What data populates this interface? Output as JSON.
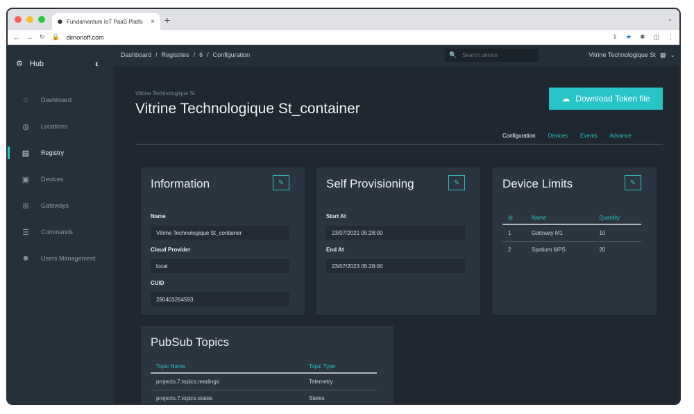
{
  "browser": {
    "tab_title": "Fundamentum IoT PaaS Platfo",
    "tab_close": "×",
    "new_tab": "+",
    "url": "dimonoff.com"
  },
  "sidebar": {
    "hub_label": "Hub",
    "collapse_icon": "‹",
    "items": [
      {
        "label": "Dashboard",
        "icon": "home-icon",
        "active": false
      },
      {
        "label": "Locations",
        "icon": "globe-icon",
        "active": false
      },
      {
        "label": "Registry",
        "icon": "clipboard-icon",
        "active": true
      },
      {
        "label": "Devices",
        "icon": "devices-icon",
        "active": false
      },
      {
        "label": "Gateways",
        "icon": "network-icon",
        "active": false
      },
      {
        "label": "Commands",
        "icon": "list-icon",
        "active": false
      },
      {
        "label": "Users Management",
        "icon": "users-icon",
        "active": false
      }
    ]
  },
  "topbar": {
    "breadcrumb": [
      "Dashboard",
      "/",
      "Registries",
      "/",
      "6",
      "/",
      "Configuration"
    ],
    "search_placeholder": "Search device",
    "org_name": "Vitrine Technologique St"
  },
  "page": {
    "subtitle": "Vitrine Technologique St",
    "title": "Vitrine Technologique St_container",
    "download_label": "Download Token file",
    "tabs": [
      "Configuration",
      "Devices",
      "Events",
      "Advance"
    ]
  },
  "information": {
    "heading": "Information",
    "name_label": "Name",
    "name_value": "Vitrine Technologique St_container",
    "cloud_label": "Cloud Provider",
    "cloud_value": "local",
    "cuid_label": "CUID",
    "cuid_value": "280403264593"
  },
  "self_provisioning": {
    "heading": "Self Provisioning",
    "start_label": "Start At",
    "start_value": "23/07/2021 05:28:00",
    "end_label": "End At",
    "end_value": "23/07/2023 05:28:00"
  },
  "device_limits": {
    "heading": "Device Limits",
    "columns": [
      "Id",
      "Name",
      "Quantity"
    ],
    "rows": [
      [
        "1",
        "Gateway M1",
        "10"
      ],
      [
        "2",
        "Spatium MPS",
        "20"
      ]
    ]
  },
  "pubsub": {
    "heading": "PubSub Topics",
    "columns": [
      "Topic Name",
      "Topic Type"
    ],
    "rows": [
      [
        "projects.7.topics.readings",
        "Telemetry"
      ],
      [
        "projects.7.topics.states",
        "States"
      ]
    ]
  },
  "colors": {
    "accent": "#28c4c8",
    "background": "#1f2830",
    "sidebar": "#263039",
    "card": "#2b353f"
  }
}
